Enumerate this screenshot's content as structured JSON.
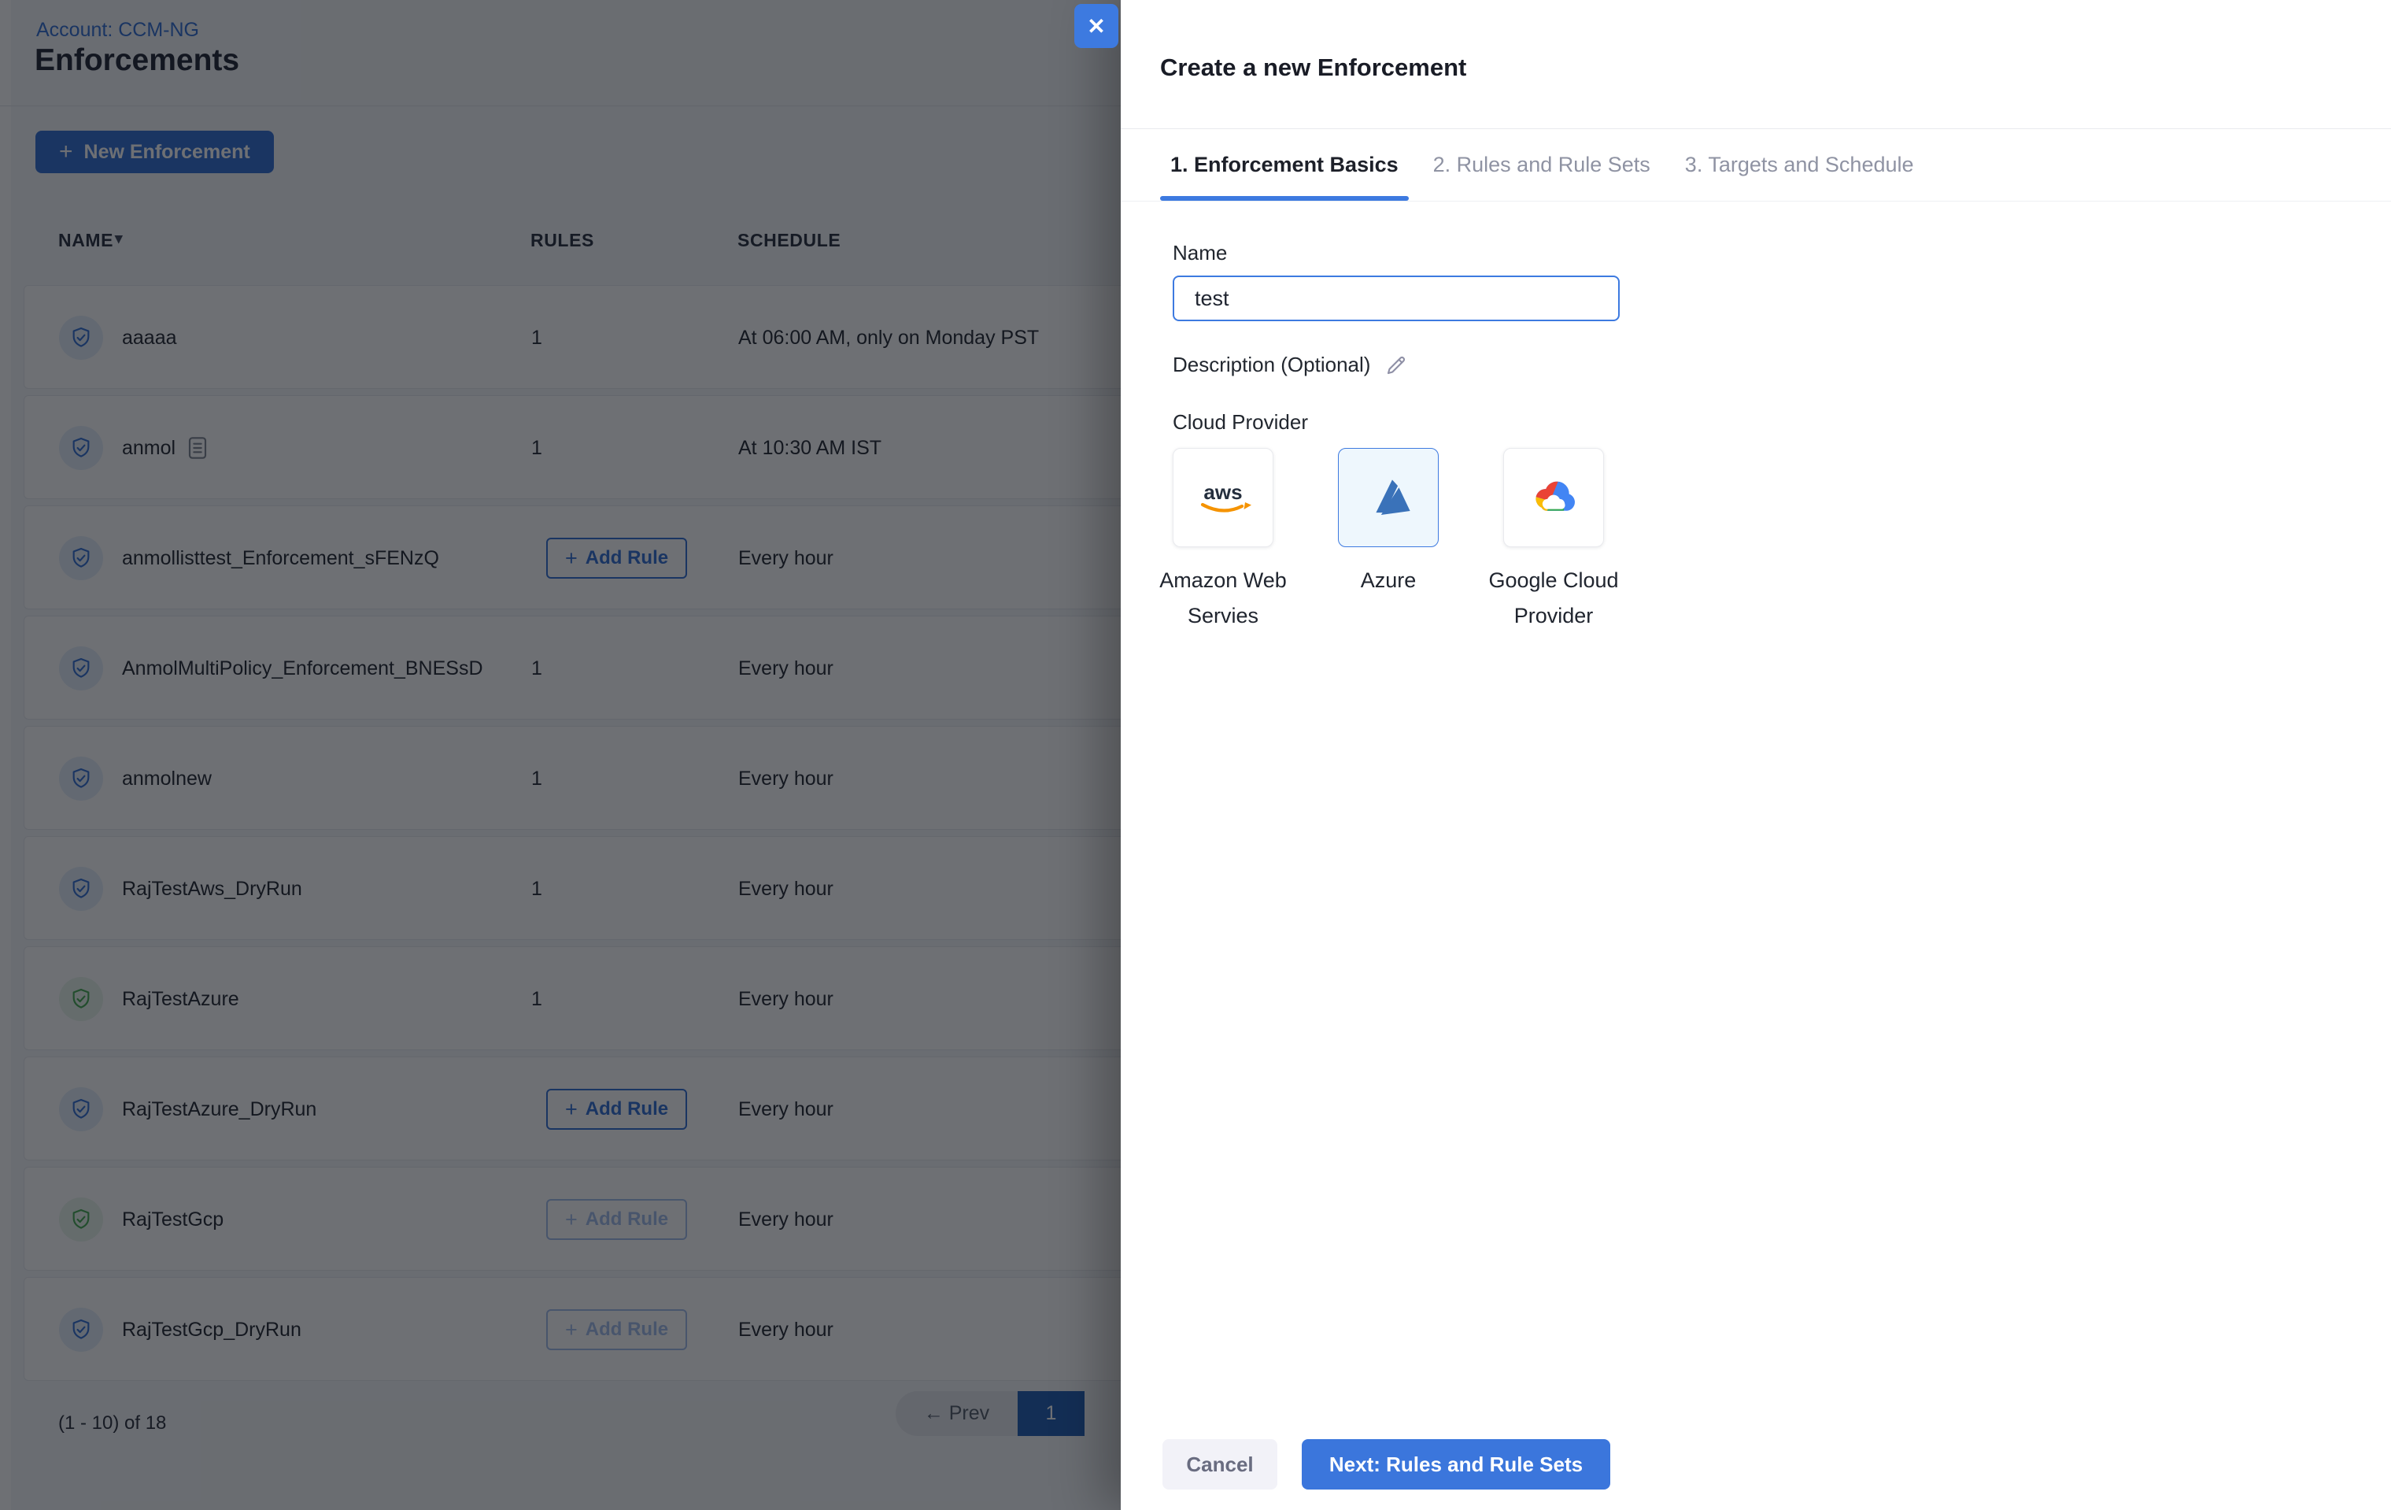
{
  "page": {
    "breadcrumb": "Account: CCM-NG",
    "title": "Enforcements",
    "new_enforcement_label": "New Enforcement",
    "table": {
      "columns": [
        "NAME",
        "RULES",
        "SCHEDULE"
      ],
      "add_rule_label": "Add Rule",
      "rows": [
        {
          "name": "aaaaa",
          "icon": "shield-blue",
          "rules": "1",
          "schedule": "At 06:00 AM, only on Monday PST"
        },
        {
          "name": "anmol",
          "icon": "shield-blue",
          "rules": "1",
          "schedule": "At 10:30 AM IST",
          "note_icon": true
        },
        {
          "name": "anmollisttest_Enforcement_sFENzQ",
          "icon": "shield-blue",
          "add_rule": "enabled",
          "schedule": "Every hour"
        },
        {
          "name": "AnmolMultiPolicy_Enforcement_BNESsD",
          "icon": "shield-blue",
          "rules": "1",
          "schedule": "Every hour"
        },
        {
          "name": "anmolnew",
          "icon": "shield-blue",
          "rules": "1",
          "schedule": "Every hour"
        },
        {
          "name": "RajTestAws_DryRun",
          "icon": "shield-blue",
          "rules": "1",
          "schedule": "Every hour"
        },
        {
          "name": "RajTestAzure",
          "icon": "shield-green",
          "rules": "1",
          "schedule": "Every hour"
        },
        {
          "name": "RajTestAzure_DryRun",
          "icon": "shield-blue",
          "add_rule": "enabled",
          "schedule": "Every hour"
        },
        {
          "name": "RajTestGcp",
          "icon": "shield-green",
          "add_rule": "disabled",
          "schedule": "Every hour"
        },
        {
          "name": "RajTestGcp_DryRun",
          "icon": "shield-blue",
          "add_rule": "disabled",
          "schedule": "Every hour"
        }
      ]
    },
    "pagination": {
      "range_text": "(1 - 10) of 18",
      "prev_label": "← Prev",
      "current_page": "1"
    }
  },
  "drawer": {
    "close_icon": "✕",
    "title": "Create a new Enforcement",
    "tabs": [
      {
        "label": "1. Enforcement Basics",
        "active": true
      },
      {
        "label": "2. Rules and Rule Sets",
        "active": false
      },
      {
        "label": "3. Targets and Schedule",
        "active": false
      }
    ],
    "form": {
      "name_label": "Name",
      "name_value": "test",
      "description_label": "Description (Optional)",
      "cloud_provider_label": "Cloud Provider",
      "providers": [
        {
          "id": "aws",
          "label": "Amazon Web Servies",
          "selected": false
        },
        {
          "id": "azure",
          "label": "Azure",
          "selected": true
        },
        {
          "id": "gcp",
          "label": "Google Cloud Provider",
          "selected": false
        }
      ]
    },
    "footer": {
      "cancel_label": "Cancel",
      "next_label": "Next: Rules and Rule Sets"
    }
  }
}
